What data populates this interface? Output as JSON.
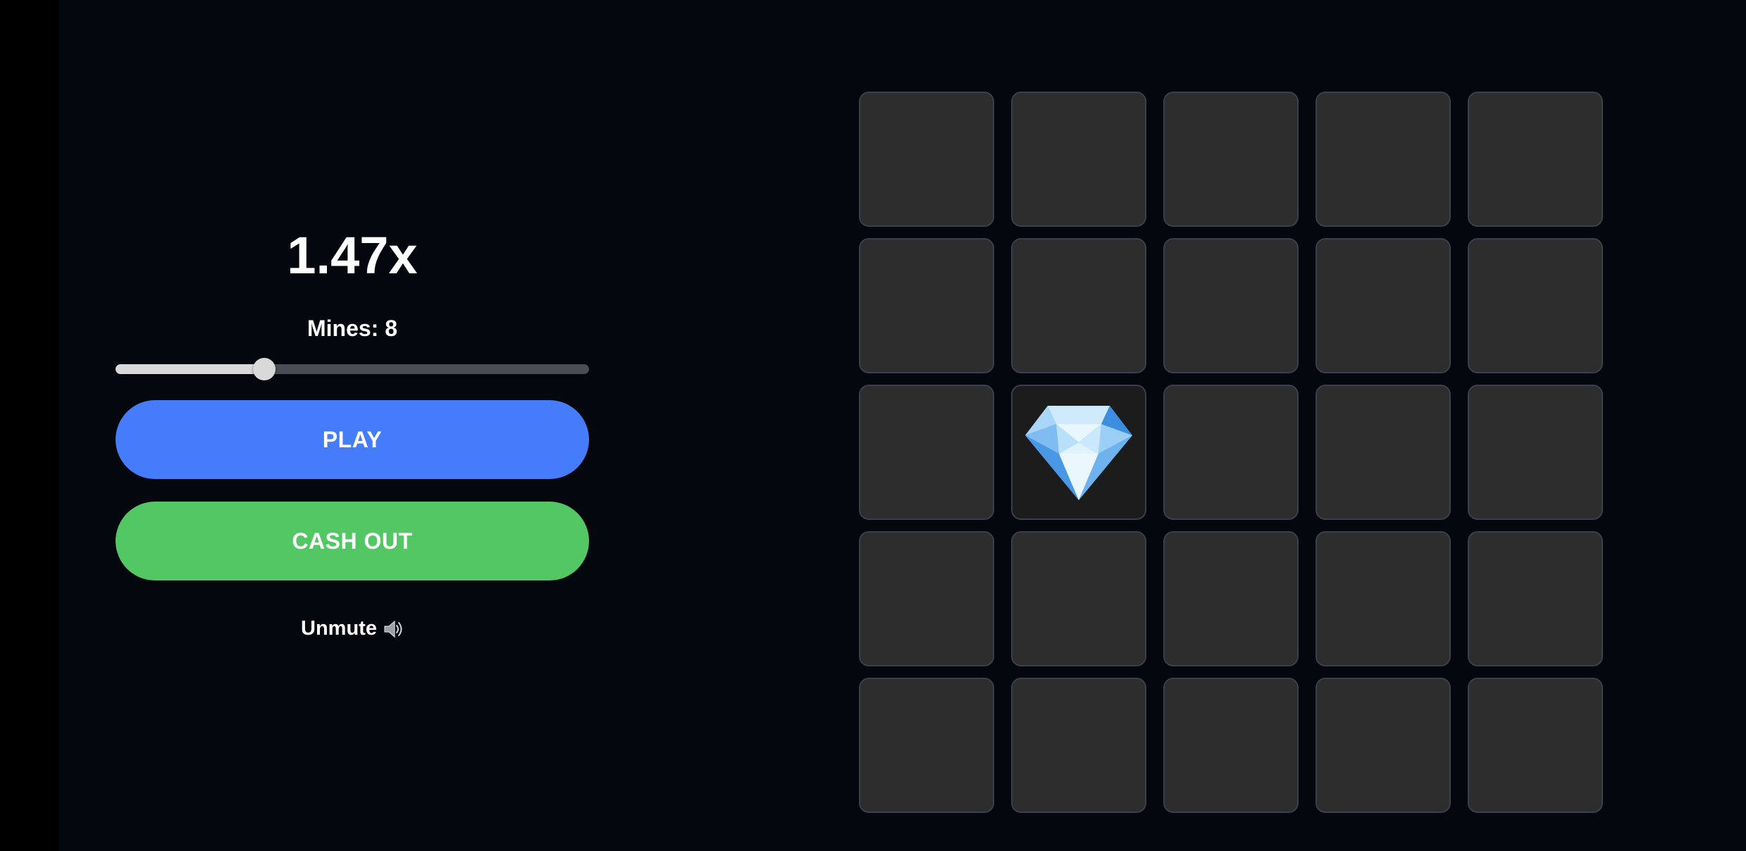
{
  "game": {
    "multiplier": "1.47x",
    "mines_label": "Mines: 8",
    "mines_value": 8,
    "mines_min": 1,
    "mines_max": 24
  },
  "buttons": {
    "play_label": "PLAY",
    "cashout_label": "CASH OUT",
    "unmute_label": "Unmute"
  },
  "icons": {
    "sound": "speaker-icon",
    "gem": "diamond-icon"
  },
  "colors": {
    "background": "#05070f",
    "play": "#457cfa",
    "cashout": "#52c764",
    "tile": "#2d2d2d",
    "tile_revealed": "#1c1c1c",
    "tile_border": "#3a3f4c"
  },
  "board": {
    "rows": 5,
    "cols": 5,
    "tiles": [
      [
        "hidden",
        "hidden",
        "hidden",
        "hidden",
        "hidden"
      ],
      [
        "hidden",
        "hidden",
        "hidden",
        "hidden",
        "hidden"
      ],
      [
        "hidden",
        "gem",
        "hidden",
        "hidden",
        "hidden"
      ],
      [
        "hidden",
        "hidden",
        "hidden",
        "hidden",
        "hidden"
      ],
      [
        "hidden",
        "hidden",
        "hidden",
        "hidden",
        "hidden"
      ]
    ]
  }
}
